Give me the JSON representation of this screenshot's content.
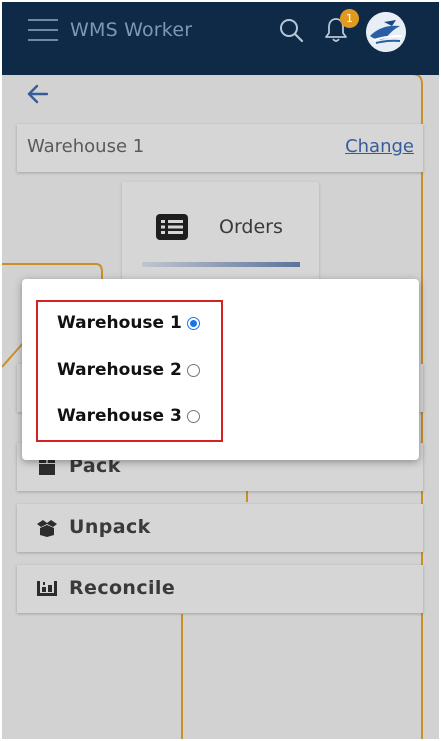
{
  "header": {
    "title": "WMS Worker",
    "notification_count": "1",
    "icons": [
      "menu-icon",
      "search-icon",
      "bell-icon",
      "avatar"
    ]
  },
  "warehouse_bar": {
    "current": "Warehouse 1",
    "change_label": "Change"
  },
  "tiles": {
    "orders_label": "Orders"
  },
  "menu": [
    {
      "label": "Pack",
      "icon": "box-icon"
    },
    {
      "label": "Unpack",
      "icon": "open-box-icon"
    },
    {
      "label": "Reconcile",
      "icon": "reconcile-icon"
    }
  ],
  "dialog": {
    "options": [
      {
        "label": "Warehouse 1",
        "selected": true
      },
      {
        "label": "Warehouse 2",
        "selected": false
      },
      {
        "label": "Warehouse 3",
        "selected": false
      }
    ]
  },
  "colors": {
    "header_bg": "#0f2a47",
    "accent_orange": "#e09a1f",
    "link_blue": "#2f5ca8",
    "highlight_red": "#d32222"
  }
}
